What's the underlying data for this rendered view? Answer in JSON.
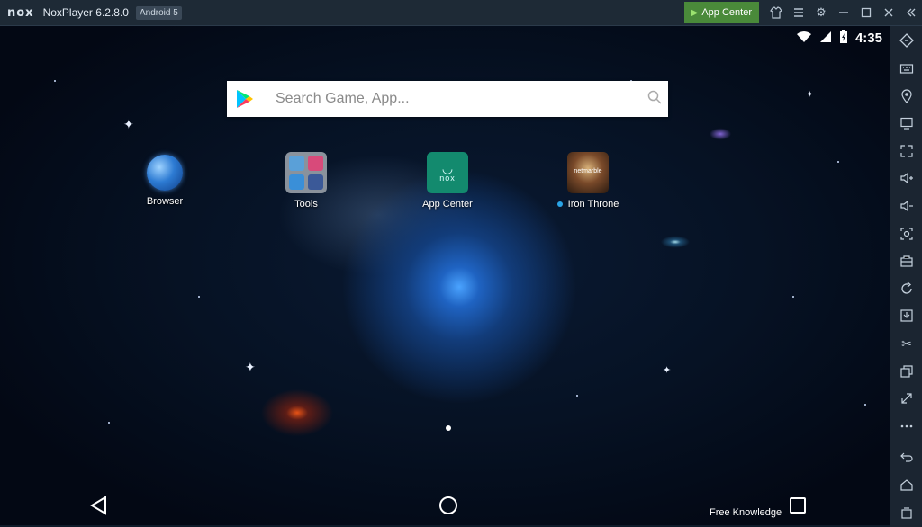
{
  "window": {
    "logo_text": "nox",
    "title": "NoxPlayer 6.2.8.0",
    "android_badge": "Android 5",
    "app_center_label": "App Center"
  },
  "status": {
    "time": "4:35"
  },
  "search": {
    "placeholder": "Search Game, App..."
  },
  "apps": [
    {
      "label": "Browser"
    },
    {
      "label": "Tools"
    },
    {
      "label": "App Center",
      "icon_text": "nox"
    },
    {
      "label": "Iron Throne",
      "icon_text": "netmarble"
    }
  ],
  "footer": {
    "watermark": "Free Knowledge"
  },
  "colors": {
    "title_bar": "#1e2a36",
    "app_center_button": "#4a8a3a",
    "sidebar": "#1b2531",
    "app_center_icon": "#138a6e"
  },
  "sidebar_icons": [
    "keyboard-shortcuts-icon",
    "keyboard-icon",
    "location-icon",
    "screen-icon",
    "fullscreen-icon",
    "volume-up-icon",
    "volume-down-icon",
    "screenshot-icon",
    "toolbox-icon",
    "rotate-icon",
    "apk-install-icon",
    "scissors-icon",
    "multi-instance-icon",
    "resize-icon",
    "more-icon",
    "back-icon",
    "home-icon",
    "recents-icon"
  ]
}
